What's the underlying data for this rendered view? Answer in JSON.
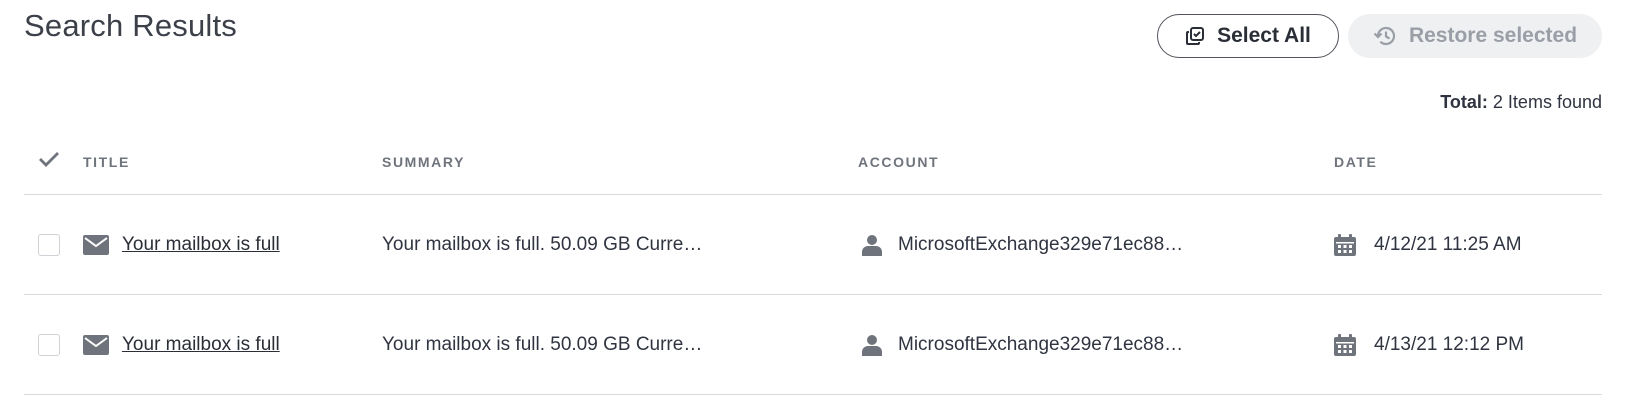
{
  "page": {
    "title": "Search Results"
  },
  "toolbar": {
    "select_all_label": "Select All",
    "select_all_icon": "copy-check-icon",
    "restore_label": "Restore selected",
    "restore_icon": "history-icon",
    "restore_disabled": true
  },
  "summary": {
    "total_label": "Total:",
    "total_value": "2 Items found"
  },
  "table": {
    "columns": {
      "check_icon": "checkmark-icon",
      "title": "TITLE",
      "summary": "SUMMARY",
      "account": "ACCOUNT",
      "date": "DATE"
    },
    "rows": [
      {
        "checked": false,
        "type_icon": "envelope-icon",
        "title": "Your mailbox is full",
        "summary": "Your mailbox is full. 50.09 GB Curre…",
        "account_icon": "person-icon",
        "account": "MicrosoftExchange329e71ec88…",
        "date_icon": "calendar-icon",
        "date": "4/12/21 11:25 AM"
      },
      {
        "checked": false,
        "type_icon": "envelope-icon",
        "title": "Your mailbox is full",
        "summary": "Your mailbox is full. 50.09 GB Curre…",
        "account_icon": "person-icon",
        "account": "MicrosoftExchange329e71ec88…",
        "date_icon": "calendar-icon",
        "date": "4/13/21 12:12 PM"
      }
    ]
  },
  "colors": {
    "text": "#2f3440",
    "header_text": "#6f747c",
    "icon": "#6f747c",
    "border": "#d8dade",
    "disabled_bg": "#eef0f2",
    "disabled_text": "#9a9ea6"
  }
}
